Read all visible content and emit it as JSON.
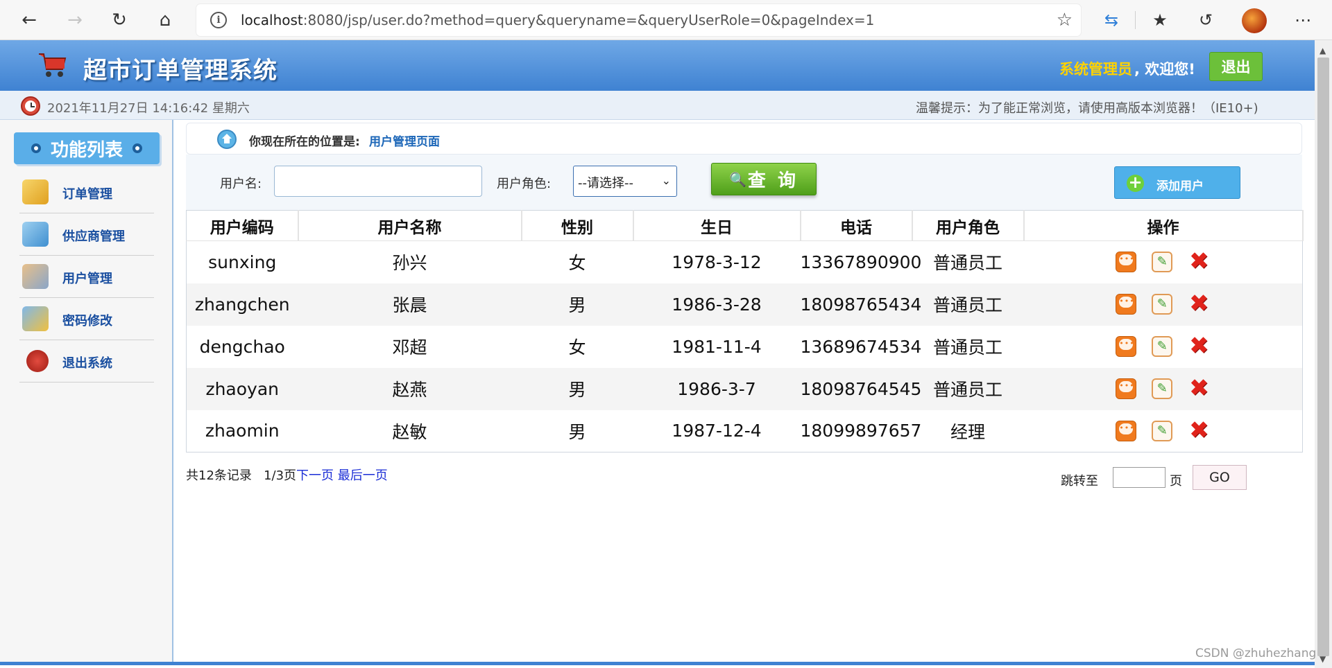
{
  "browser": {
    "url_host": "localhost",
    "url_rest": ":8080/jsp/user.do?method=query&queryname=&queryUserRole=0&pageIndex=1",
    "back_icon": "back-arrow-icon",
    "forward_icon": "forward-arrow-icon",
    "refresh_icon": "refresh-icon",
    "home_icon": "home-icon"
  },
  "header": {
    "title": "超市订单管理系统",
    "admin_name": "系统管理员",
    "welcome": ", 欢迎您!",
    "logout": "退出"
  },
  "timebar": {
    "datetime": "2021年11月27日 14:16:42 星期六",
    "tip": "温馨提示：为了能正常浏览，请使用高版本浏览器！（IE10+)"
  },
  "sidebar": {
    "title": "功能列表",
    "items": [
      {
        "label": "订单管理",
        "icon": "order-icon",
        "color": "#f0c44a"
      },
      {
        "label": "供应商管理",
        "icon": "supplier-icon",
        "color": "#6aaed6"
      },
      {
        "label": "用户管理",
        "icon": "users-icon",
        "color": "#d6a36a"
      },
      {
        "label": "密码修改",
        "icon": "password-icon",
        "color": "#5c9bd6"
      },
      {
        "label": "退出系统",
        "icon": "exit-icon",
        "color": "#c62a2a"
      }
    ]
  },
  "breadcrumb": {
    "prefix": "你现在所在的位置是:",
    "current": "用户管理页面"
  },
  "search": {
    "username_label": "用户名:",
    "username_value": "",
    "role_label": "用户角色:",
    "role_selected": "--请选择--",
    "query_button": "查 询",
    "add_button": "添加用户"
  },
  "table": {
    "columns": [
      "用户编码",
      "用户名称",
      "性别",
      "生日",
      "电话",
      "用户角色",
      "操作"
    ],
    "rows": [
      [
        "sunxing",
        "孙兴",
        "女",
        "1978-3-12",
        "13367890900",
        "普通员工"
      ],
      [
        "zhangchen",
        "张晨",
        "男",
        "1986-3-28",
        "18098765434",
        "普通员工"
      ],
      [
        "dengchao",
        "邓超",
        "女",
        "1981-11-4",
        "13689674534",
        "普通员工"
      ],
      [
        "zhaoyan",
        "赵燕",
        "男",
        "1986-3-7",
        "18098764545",
        "普通员工"
      ],
      [
        "zhaomin",
        "赵敏",
        "男",
        "1987-12-4",
        "18099897657",
        "经理"
      ]
    ]
  },
  "pagination": {
    "total": "共12条记录",
    "pages": "1/3页",
    "next": "下一页",
    "last": "最后一页",
    "jump_label": "跳转至",
    "unit": "页",
    "go": "GO"
  },
  "watermark": "CSDN @zhuhezhang",
  "colors": {
    "header_blue": "#3f82d2",
    "admin_yellow": "#ffd200",
    "logout_green": "#6cc03a",
    "query_green": "#4f9f1a",
    "add_blue": "#4fb0ea",
    "link_blue": "#1a2dd6"
  }
}
